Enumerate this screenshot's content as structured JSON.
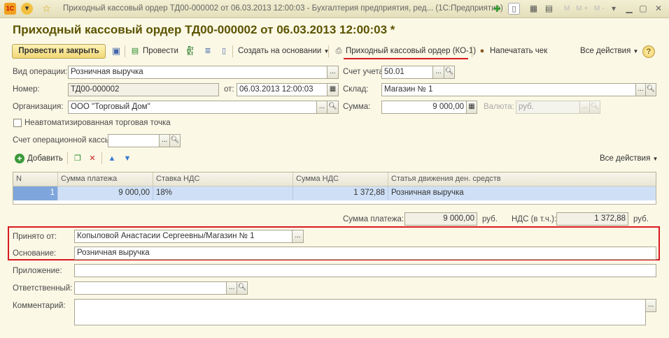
{
  "window": {
    "title": "Приходный кассовый ордер ТД00-000002 от 06.03.2013 12:00:03 - Бухгалтерия предприятия, ред...   (1С:Предприятие)",
    "logo": "1С",
    "right_small": "M  M+  M-"
  },
  "header": {
    "title": "Приходный кассовый ордер ТД00-000002 от 06.03.2013 12:00:03 *"
  },
  "toolbar": {
    "post_close": "Провести и закрыть",
    "post": "Провести",
    "dt_kt": "Дт Кт",
    "create_based": "Создать на основании",
    "print_ko1": "Приходный кассовый ордер (КО-1)",
    "print_check": "Напечатать чек",
    "all_actions": "Все действия",
    "help": "?"
  },
  "form": {
    "op_type_label": "Вид операции:",
    "op_type_value": "Розничная выручка",
    "account_label": "Счет учета:",
    "account_value": "50.01",
    "number_label": "Номер:",
    "number_value": "ТД00-000002",
    "date_label": "от:",
    "date_value": "06.03.2013 12:00:03",
    "warehouse_label": "Склад:",
    "warehouse_value": "Магазин № 1",
    "org_label": "Организация:",
    "org_value": "ООО \"Торговый Дом\"",
    "sum_label": "Сумма:",
    "sum_value": "9 000,00",
    "currency_label": "Валюта:",
    "currency_value": "руб.",
    "nonauto_label": "Неавтоматизированная торговая точка",
    "cash_account_label": "Счет операционной кассы:",
    "cash_account_value": ""
  },
  "table_toolbar": {
    "add": "Добавить",
    "all_actions": "Все действия"
  },
  "table": {
    "headers": [
      "N",
      "Сумма платежа",
      "Ставка НДС",
      "Сумма НДС",
      "Статья движения ден. средств"
    ],
    "rows": [
      [
        "1",
        "9 000,00",
        "18%",
        "1 372,88",
        "Розничная выручка"
      ]
    ]
  },
  "totals": {
    "payment_label": "Сумма платежа:",
    "payment_value": "9 000,00",
    "payment_cur": "руб.",
    "vat_label": "НДС (в т.ч.):",
    "vat_value": "1 372,88",
    "vat_cur": "руб."
  },
  "bottom": {
    "received_label": "Принято от:",
    "received_value": "Копыловой Анастасии Сергеевны/Магазин № 1",
    "basis_label": "Основание:",
    "basis_value": "Розничная выручка",
    "attachment_label": "Приложение:",
    "attachment_value": "",
    "responsible_label": "Ответственный:",
    "responsible_value": "",
    "comment_label": "Комментарий:",
    "comment_value": ""
  },
  "colors": {
    "highlight": "#d71a20",
    "selected_row": "#cfe0f6",
    "background": "#fbf8e6"
  }
}
